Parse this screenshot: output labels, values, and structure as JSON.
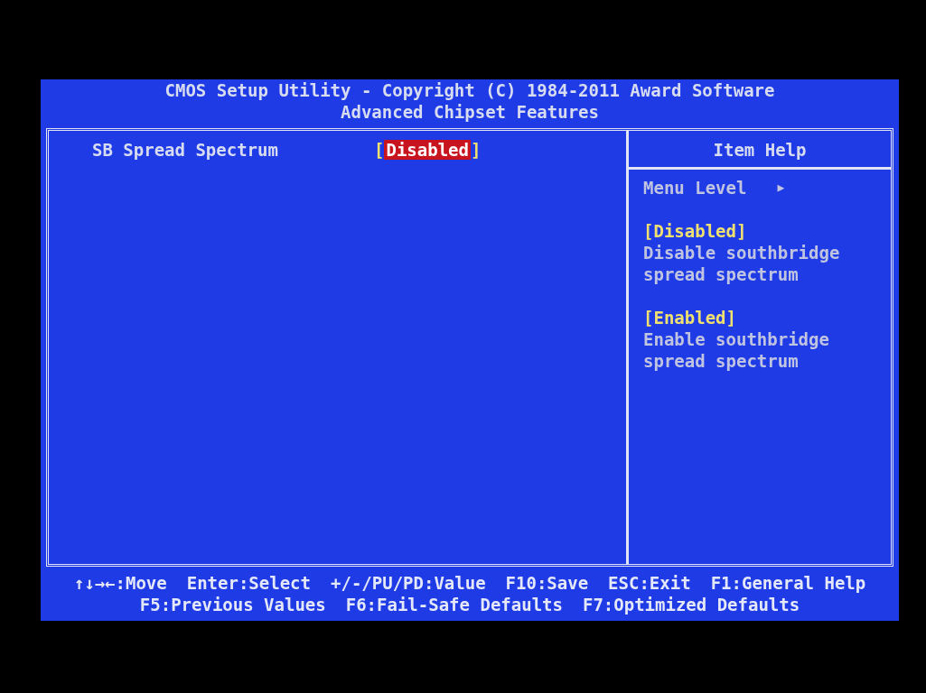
{
  "header": {
    "title": "CMOS Setup Utility - Copyright (C) 1984-2011 Award Software",
    "subtitle": "Advanced Chipset Features"
  },
  "settings": [
    {
      "label": "SB Spread Spectrum",
      "bracket_open": "[",
      "value": "Disabled",
      "bracket_close": "]",
      "selected": true
    }
  ],
  "help": {
    "title": "Item Help",
    "menu_level": "Menu Level",
    "menu_level_arrow": "▶",
    "options": [
      {
        "name": "[Disabled]",
        "lines": [
          "Disable southbridge",
          "spread spectrum"
        ]
      },
      {
        "name": "[Enabled]",
        "lines": [
          "Enable southbridge",
          "spread spectrum"
        ]
      }
    ]
  },
  "footer": [
    [
      "↑↓→←:Move",
      "Enter:Select",
      "+/-/PU/PD:Value",
      "F10:Save",
      "ESC:Exit",
      "F1:General Help"
    ],
    [
      "F5:Previous Values",
      "F6:Fail-Safe Defaults",
      "F7:Optimized Defaults"
    ]
  ]
}
